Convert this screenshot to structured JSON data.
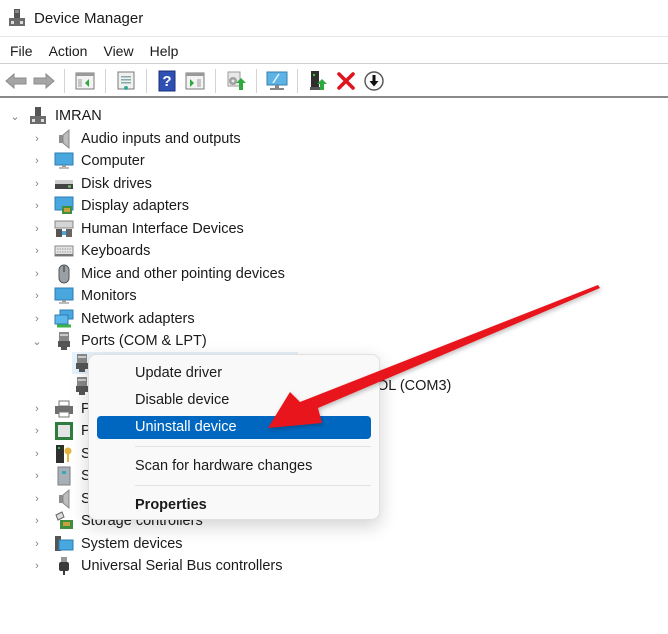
{
  "window": {
    "title": "Device Manager",
    "app_icon": "device-manager-icon"
  },
  "menubar": {
    "items": [
      {
        "label": "File"
      },
      {
        "label": "Action"
      },
      {
        "label": "View"
      },
      {
        "label": "Help"
      }
    ]
  },
  "toolbar": {
    "buttons": [
      {
        "icon": "back-arrow-icon"
      },
      {
        "icon": "forward-arrow-icon"
      },
      {
        "icon": "show-hide-console-tree-icon"
      },
      {
        "icon": "properties-icon"
      },
      {
        "icon": "help-icon"
      },
      {
        "icon": "show-hide-action-pane-icon"
      },
      {
        "icon": "update-driver-icon"
      },
      {
        "icon": "scan-hardware-icon"
      },
      {
        "icon": "enable-device-icon"
      },
      {
        "icon": "uninstall-device-icon"
      },
      {
        "icon": "disable-device-icon"
      }
    ]
  },
  "tree": {
    "root": {
      "label": "IMRAN",
      "icon": "computer-tower-icon",
      "expanded": true
    },
    "categories": [
      {
        "label": "Audio inputs and outputs",
        "icon": "speaker-icon"
      },
      {
        "label": "Computer",
        "icon": "monitor-icon"
      },
      {
        "label": "Disk drives",
        "icon": "disk-drive-icon"
      },
      {
        "label": "Display adapters",
        "icon": "display-adapter-icon"
      },
      {
        "label": "Human Interface Devices",
        "icon": "hid-icon"
      },
      {
        "label": "Keyboards",
        "icon": "keyboard-icon"
      },
      {
        "label": "Mice and other pointing devices",
        "icon": "mouse-icon"
      },
      {
        "label": "Monitors",
        "icon": "monitor-icon"
      },
      {
        "label": "Network adapters",
        "icon": "network-adapter-icon"
      },
      {
        "label": "Ports (COM & LPT)",
        "icon": "port-icon",
        "expanded": true
      },
      {
        "label": "Pr",
        "icon": "printer-icon"
      },
      {
        "label": "Pr",
        "icon": "processor-icon"
      },
      {
        "label": "Se",
        "icon": "security-device-icon"
      },
      {
        "label": "So",
        "icon": "software-device-icon"
      },
      {
        "label": "So",
        "icon": "speaker-icon"
      },
      {
        "label": "Storage controllers",
        "icon": "storage-controller-icon"
      },
      {
        "label": "System devices",
        "icon": "system-devices-icon"
      },
      {
        "label": "Universal Serial Bus controllers",
        "icon": "usb-icon"
      }
    ],
    "port_children": [
      {
        "label": "",
        "icon": "port-icon",
        "highlighted": true
      },
      {
        "label": "OL (COM3)",
        "icon": "port-icon"
      }
    ]
  },
  "context_menu": {
    "items": [
      {
        "label": "Update driver"
      },
      {
        "label": "Disable device"
      },
      {
        "label": "Uninstall device",
        "active": true
      },
      {
        "label": "Scan for hardware changes"
      },
      {
        "label": "Properties",
        "bold": true
      }
    ]
  },
  "colors": {
    "selection": "#0067c0",
    "annotation_arrow": "#e8141a",
    "hover": "#e5f1fb"
  }
}
